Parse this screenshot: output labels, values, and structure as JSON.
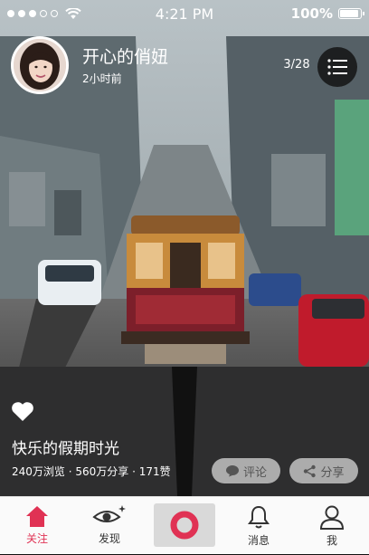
{
  "status_bar": {
    "time": "4:21 PM",
    "battery": "100%",
    "signal_dots": 5,
    "signal_filled": 3
  },
  "header": {
    "username": "开心的俏妞",
    "post_time": "2小时前",
    "counter": "3/28"
  },
  "post": {
    "title": "快乐的假期时光",
    "stats": "240万浏览 · 560万分享 · 171赞",
    "comment_label": "评论",
    "share_label": "分享"
  },
  "tabbar": {
    "items": [
      {
        "label": "关注",
        "icon": "home-icon",
        "active": true
      },
      {
        "label": "发现",
        "icon": "eye-icon",
        "active": false
      },
      {
        "label": "",
        "icon": "record-icon",
        "active": false
      },
      {
        "label": "消息",
        "icon": "bell-icon",
        "active": false
      },
      {
        "label": "我",
        "icon": "user-icon",
        "active": false
      }
    ]
  },
  "colors": {
    "accent": "#e03254",
    "pill_bg": "#c8c8c8",
    "tabbar_bg": "#fafafa"
  }
}
